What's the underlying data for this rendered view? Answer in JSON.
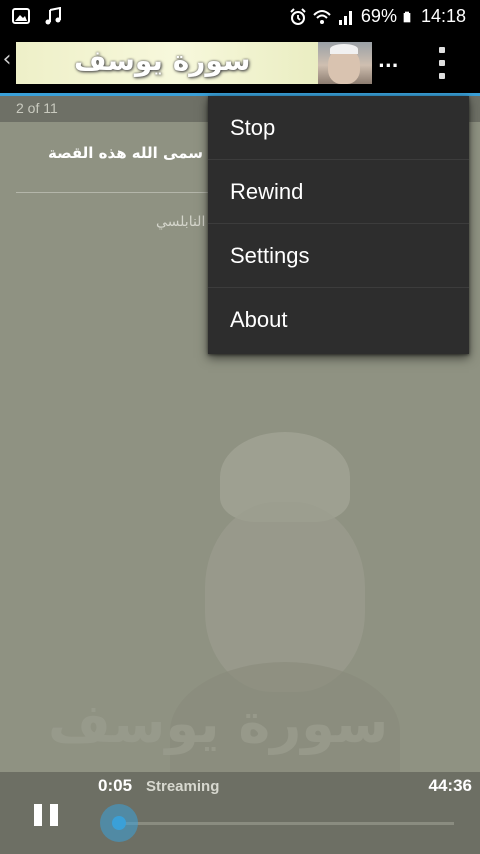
{
  "status_bar": {
    "battery_percent": "69%",
    "time": "14:18",
    "left_icons": [
      "image-icon",
      "music-note-icon"
    ],
    "right_icons": [
      "alarm-icon",
      "wifi-icon",
      "signal-icon",
      "battery-icon"
    ]
  },
  "app_bar": {
    "banner_title": "سورة يوسف",
    "ellipsis": "...",
    "accent_color": "#3aa0d8"
  },
  "pager": {
    "text": "2 of 11"
  },
  "content": {
    "item_title": "اذا سمى الله هذه القصة",
    "item_subtitle": "النابلسي",
    "watermark_text": "سورة يوسف"
  },
  "menu": {
    "items": [
      {
        "label": "Stop"
      },
      {
        "label": "Rewind"
      },
      {
        "label": "Settings"
      },
      {
        "label": "About"
      }
    ]
  },
  "player": {
    "elapsed": "0:05",
    "status": "Streaming",
    "duration": "44:36",
    "progress_fraction": 0.002
  }
}
